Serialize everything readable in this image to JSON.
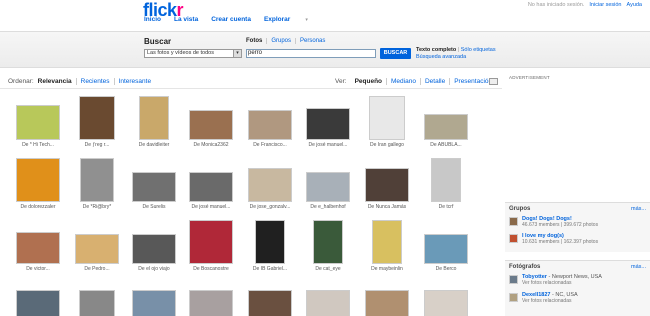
{
  "header": {
    "logo_main": "flick",
    "logo_accent": "r",
    "nav": [
      "Inicio",
      "La vista",
      "Crear cuenta",
      "Explorar"
    ],
    "nav_caret": "▾",
    "account": {
      "status": "No has iniciado sesión.",
      "signin": "Iniciar sesión",
      "help": "Ayuda"
    }
  },
  "search": {
    "title": "Buscar",
    "tabs": [
      "Fotos",
      "Grupos",
      "Personas"
    ],
    "scope": "Las fotos y vídeos de todos",
    "query": "perro",
    "button": "BUSCAR",
    "fulltext": "Texto completo",
    "tags_only": "Sólo etiquetas",
    "advanced": "Búsqueda avanzada"
  },
  "sort": {
    "label": "Ordenar:",
    "options": [
      "Relevancia",
      "Recientes",
      "Interesante"
    ],
    "active": "Relevancia"
  },
  "view": {
    "label": "Ver:",
    "options": [
      "Pequeño",
      "Mediano",
      "Detalle",
      "Presentación"
    ],
    "active": "Pequeño"
  },
  "photos": [
    {
      "caption": "De * Hi Tech...",
      "color": "#b8c85a",
      "w": 44,
      "h": 35
    },
    {
      "caption": "De ƒreg r...",
      "color": "#6a4a30",
      "w": 36,
      "h": 44
    },
    {
      "caption": "De davidleiter",
      "color": "#c9a86a",
      "w": 30,
      "h": 44
    },
    {
      "caption": "De Monica2362",
      "color": "#9a7050",
      "w": 44,
      "h": 30
    },
    {
      "caption": "De Francisco...",
      "color": "#b09880",
      "w": 44,
      "h": 30
    },
    {
      "caption": "De josé manuel...",
      "color": "#3a3a3a",
      "w": 44,
      "h": 32
    },
    {
      "caption": "De Iran gallego",
      "color": "#e8e8e8",
      "w": 36,
      "h": 44
    },
    {
      "caption": "De ABUBLA...",
      "color": "#b0a890",
      "w": 44,
      "h": 26
    },
    {
      "caption": "De dolorezzaler",
      "color": "#e0901a",
      "w": 44,
      "h": 44
    },
    {
      "caption": "De *Ri@bry*",
      "color": "#909090",
      "w": 34,
      "h": 44
    },
    {
      "caption": "De Surelis",
      "color": "#707070",
      "w": 44,
      "h": 30
    },
    {
      "caption": "De josé manuel...",
      "color": "#6a6a6a",
      "w": 44,
      "h": 30
    },
    {
      "caption": "De jose_gonzalv...",
      "color": "#c8b8a0",
      "w": 44,
      "h": 34
    },
    {
      "caption": "De e_halbenhof",
      "color": "#a8b0b8",
      "w": 44,
      "h": 30
    },
    {
      "caption": "De Nunca Jamás",
      "color": "#504038",
      "w": 44,
      "h": 34
    },
    {
      "caption": "De tcrf",
      "color": "#c8c8c8",
      "w": 30,
      "h": 44
    },
    {
      "caption": "De victor...",
      "color": "#b07050",
      "w": 44,
      "h": 32
    },
    {
      "caption": "De Pedro...",
      "color": "#d8b070",
      "w": 44,
      "h": 30
    },
    {
      "caption": "De el ojo viajo",
      "color": "#585858",
      "w": 44,
      "h": 30
    },
    {
      "caption": "De Boscanostre",
      "color": "#b02838",
      "w": 44,
      "h": 44
    },
    {
      "caption": "De IB Gabriel...",
      "color": "#202020",
      "w": 30,
      "h": 44
    },
    {
      "caption": "De cat_eye",
      "color": "#3a5a3a",
      "w": 30,
      "h": 44
    },
    {
      "caption": "De maybeinlin",
      "color": "#d8c060",
      "w": 30,
      "h": 44
    },
    {
      "caption": "De Berco",
      "color": "#6a9ab8",
      "w": 44,
      "h": 30
    },
    {
      "caption": "",
      "color": "#5a6a78",
      "w": 44,
      "h": 36
    },
    {
      "caption": "",
      "color": "#888888",
      "w": 36,
      "h": 36
    },
    {
      "caption": "",
      "color": "#7890a8",
      "w": 44,
      "h": 36
    },
    {
      "caption": "",
      "color": "#a8a0a0",
      "w": 44,
      "h": 36
    },
    {
      "caption": "",
      "color": "#6a5040",
      "w": 44,
      "h": 36
    },
    {
      "caption": "",
      "color": "#d0c8c0",
      "w": 44,
      "h": 36
    },
    {
      "caption": "",
      "color": "#b09070",
      "w": 44,
      "h": 36
    },
    {
      "caption": "",
      "color": "#d8d0c8",
      "w": 44,
      "h": 36
    }
  ],
  "sidebar": {
    "ad_label": "ADVERTISEMENT",
    "groups": {
      "title": "Grupos",
      "more": "más...",
      "items": [
        {
          "name": "Dogs! Dogs! Dogs!",
          "sub": "46.673 members | 399.672 photos",
          "color": "#8a6a4a"
        },
        {
          "name": "I love my dog(s)",
          "sub": "10.631 members | 162.397 photos",
          "color": "#c05030"
        }
      ]
    },
    "photographers": {
      "title": "Fotógrafos",
      "more": "más...",
      "items": [
        {
          "name": "Tobyotter",
          "place": " - Newport News, USA",
          "sub": "Ver fotos relacionadas",
          "color": "#6a7a8a"
        },
        {
          "name": "Dexell1827",
          "place": " - NC, USA",
          "sub": "Ver fotos relacionadas",
          "color": "#b0a080"
        }
      ]
    }
  }
}
